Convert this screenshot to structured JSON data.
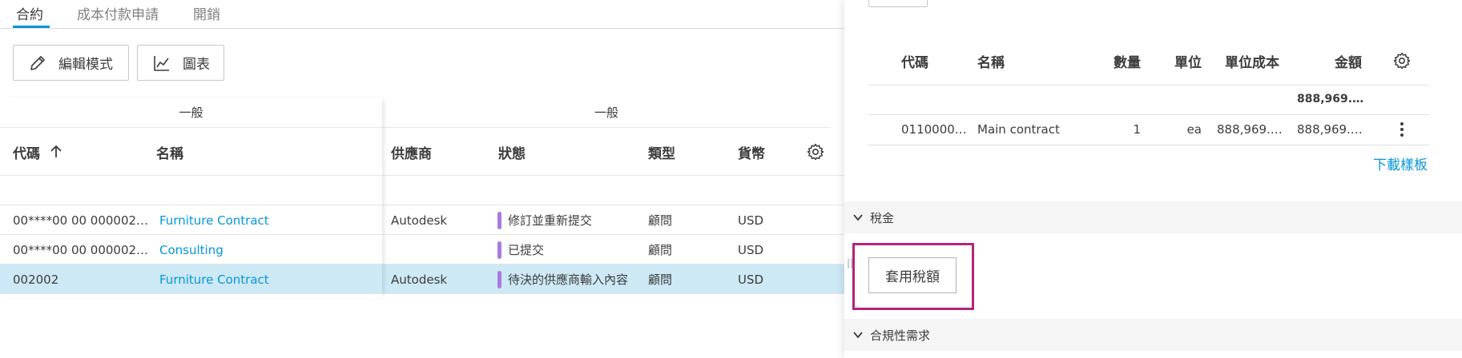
{
  "tabs": [
    {
      "label": "合約",
      "active": true
    },
    {
      "label": "成本付款申請",
      "active": false
    },
    {
      "label": "開銷",
      "active": false
    }
  ],
  "toolbar": {
    "edit_mode_label": "編輯模式",
    "chart_label": "圖表"
  },
  "table": {
    "group_headers": [
      "一般",
      "一般"
    ],
    "columns": {
      "code": "代碼",
      "name": "名稱",
      "supplier": "供應商",
      "status": "狀態",
      "type": "類型",
      "currency": "貨幣"
    },
    "rows": [
      {
        "code": "00****00 00 000002…",
        "name": "Furniture Contract",
        "supplier": "Autodesk",
        "status": "修訂並重新提交",
        "type": "顧問",
        "currency": "USD",
        "selected": false
      },
      {
        "code": "00****00 00 000002…",
        "name": "Consulting",
        "supplier": "",
        "status": "已提交",
        "type": "顧問",
        "currency": "USD",
        "selected": false
      },
      {
        "code": "002002",
        "name": "Furniture Contract",
        "supplier": "Autodesk",
        "status": "待決的供應商輸入內容",
        "type": "顧問",
        "currency": "USD",
        "selected": true
      }
    ],
    "status_color": "#a87ae0",
    "selected_row_color": "#cde9f5",
    "link_color": "#0696d7"
  },
  "panel": {
    "line_items": {
      "columns": {
        "code": "代碼",
        "name": "名稱",
        "quantity": "數量",
        "unit": "單位",
        "unit_cost": "單位成本",
        "amount": "金額"
      },
      "total_amount": "888,969.…",
      "rows": [
        {
          "code": "0110000…",
          "name": "Main contract",
          "quantity": "1",
          "unit": "ea",
          "unit_cost": "888,969.…",
          "amount": "888,969.…"
        }
      ],
      "download_template_label": "下載樣板"
    },
    "tax_section": {
      "title": "稅金",
      "apply_tax_label": "套用稅額"
    },
    "compliance_section": {
      "title": "合規性需求"
    },
    "highlight_color": "#b5247a"
  }
}
